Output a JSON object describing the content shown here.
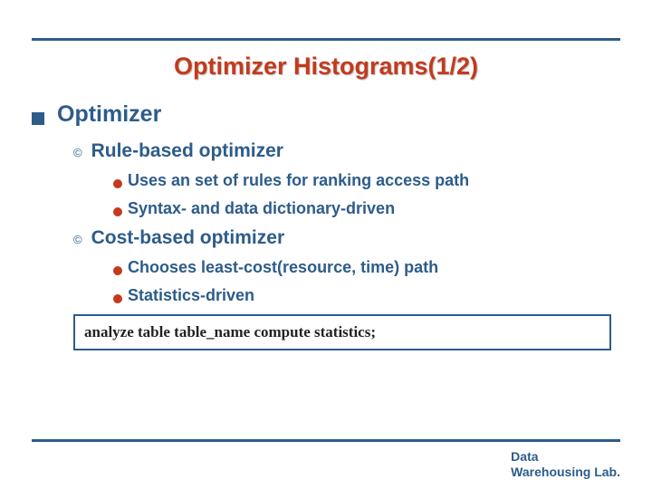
{
  "title": "Optimizer Histograms(1/2)",
  "main": {
    "heading": "Optimizer",
    "sections": [
      {
        "label": "Rule-based optimizer",
        "items": [
          "Uses an set of rules for ranking access path",
          "Syntax- and data dictionary-driven"
        ]
      },
      {
        "label": "Cost-based optimizer",
        "items": [
          "Chooses least-cost(resource, time) path",
          "Statistics-driven"
        ]
      }
    ]
  },
  "code": "analyze table table_name compute statistics;",
  "footer": {
    "line1": "Data",
    "line2": "Warehousing Lab."
  }
}
